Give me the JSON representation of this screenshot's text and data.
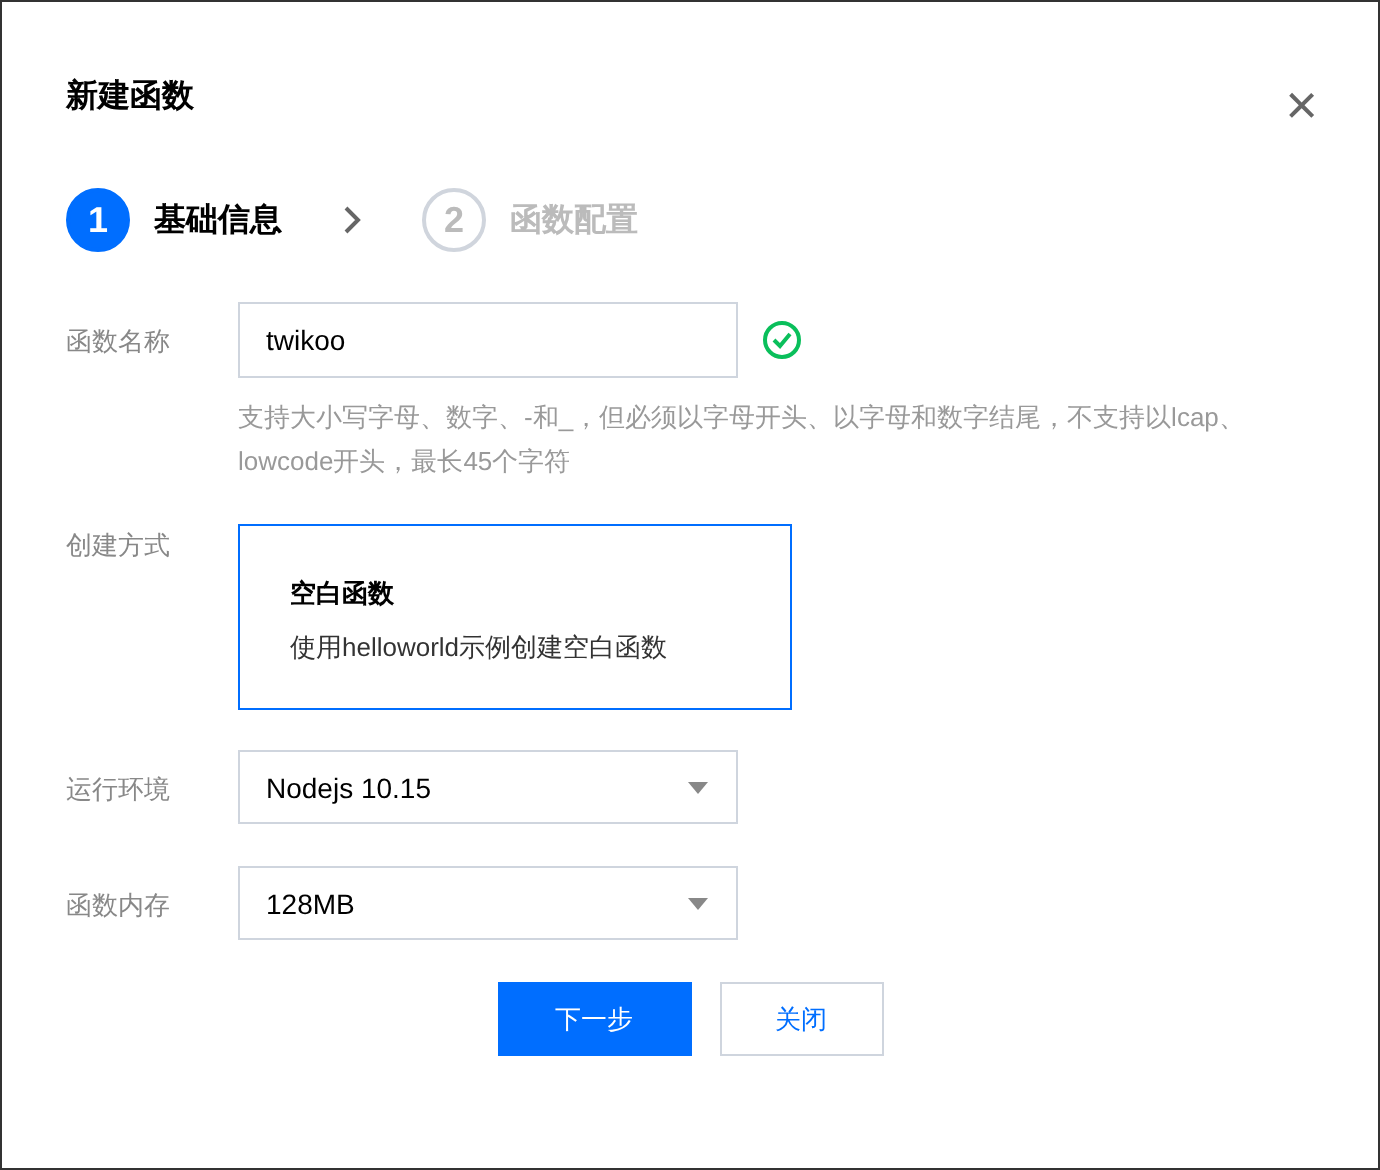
{
  "dialog": {
    "title": "新建函数",
    "close": "×"
  },
  "steps": [
    {
      "number": "1",
      "label": "基础信息",
      "selected": true
    },
    {
      "number": "2",
      "label": "函数配置",
      "selected": false
    }
  ],
  "form": [
    {
      "kind": "input",
      "label": "函数名称",
      "value": "twikoo",
      "valid": true,
      "hint": "支持大小写字母、数字、-和_，但必须以字母开头、以字母和数字结尾，不支持以lcap、lowcode开头，最长45个字符"
    },
    {
      "kind": "card",
      "label": "创建方式",
      "title": "空白函数",
      "description": "使用helloworld示例创建空白函数",
      "selected": true
    },
    {
      "kind": "select",
      "label": "运行环境",
      "value": "Nodejs 10.15"
    },
    {
      "kind": "select",
      "label": "函数内存",
      "value": "128MB"
    }
  ],
  "buttons": [
    {
      "label": "下一步",
      "kind": "primary"
    },
    {
      "label": "关闭",
      "kind": "secondary"
    }
  ]
}
